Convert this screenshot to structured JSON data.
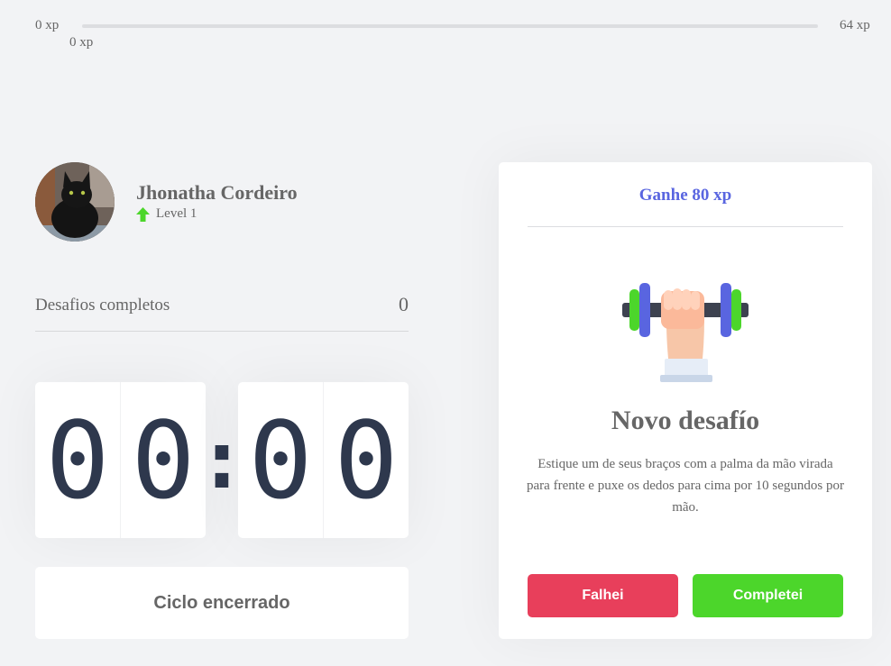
{
  "xp_bar": {
    "min_label": "0 xp",
    "max_label": "64 xp",
    "current_label": "0 xp",
    "progress_percent": 0
  },
  "profile": {
    "name": "Jhonatha Cordeiro",
    "level_label": "Level 1"
  },
  "challenges": {
    "label": "Desafios completos",
    "count": "0"
  },
  "countdown": {
    "minutes": [
      "0",
      "0"
    ],
    "separator": ":",
    "seconds": [
      "0",
      "0"
    ]
  },
  "cycle_button": {
    "label": "Ciclo encerrado"
  },
  "challenge_card": {
    "header": "Ganhe 80 xp",
    "icon": "dumbbell-hand-icon",
    "title": "Novo desafío",
    "description": "Estique um de seus braços com a palma da mão virada para frente e puxe os dedos para cima por 10 segundos por mão.",
    "failed_label": "Falhei",
    "completed_label": "Completei"
  },
  "colors": {
    "background": "#f2f3f5",
    "text": "#666666",
    "accent_blue": "#5965e0",
    "red": "#e83f5b",
    "green": "#4cd62b",
    "digits": "#2e384d"
  }
}
